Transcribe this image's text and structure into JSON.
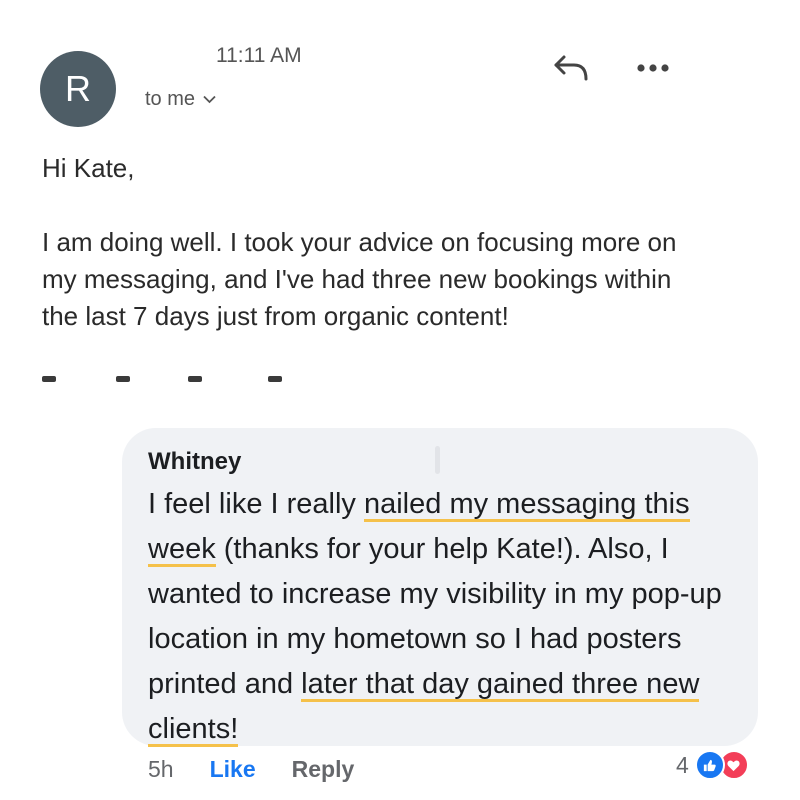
{
  "email": {
    "sender_initial": "R",
    "time": "11:11 AM",
    "recipient_label": "to me",
    "greeting": "Hi Kate,",
    "paragraph": "I am doing well. I took your advice on focusing more on my messaging, and I've had three new bookings within the last 7 days just from organic content!"
  },
  "comment": {
    "author": "Whitney",
    "text_part1": "I feel like I really ",
    "highlight1": "nailed my messaging this week",
    "text_part2": " (thanks for your help Kate!). Also, I wanted to increase my visibility in my pop-up location in my hometown so I had posters printed and ",
    "highlight2": "later that day gained three new clients!",
    "age": "5h",
    "like_label": "Like",
    "reply_label": "Reply",
    "reaction_count": "4"
  },
  "colors": {
    "avatar_bg": "#4e5d66",
    "highlight_underline": "#f5c14a",
    "like_blue": "#1877f2",
    "love_red": "#f33e58"
  }
}
